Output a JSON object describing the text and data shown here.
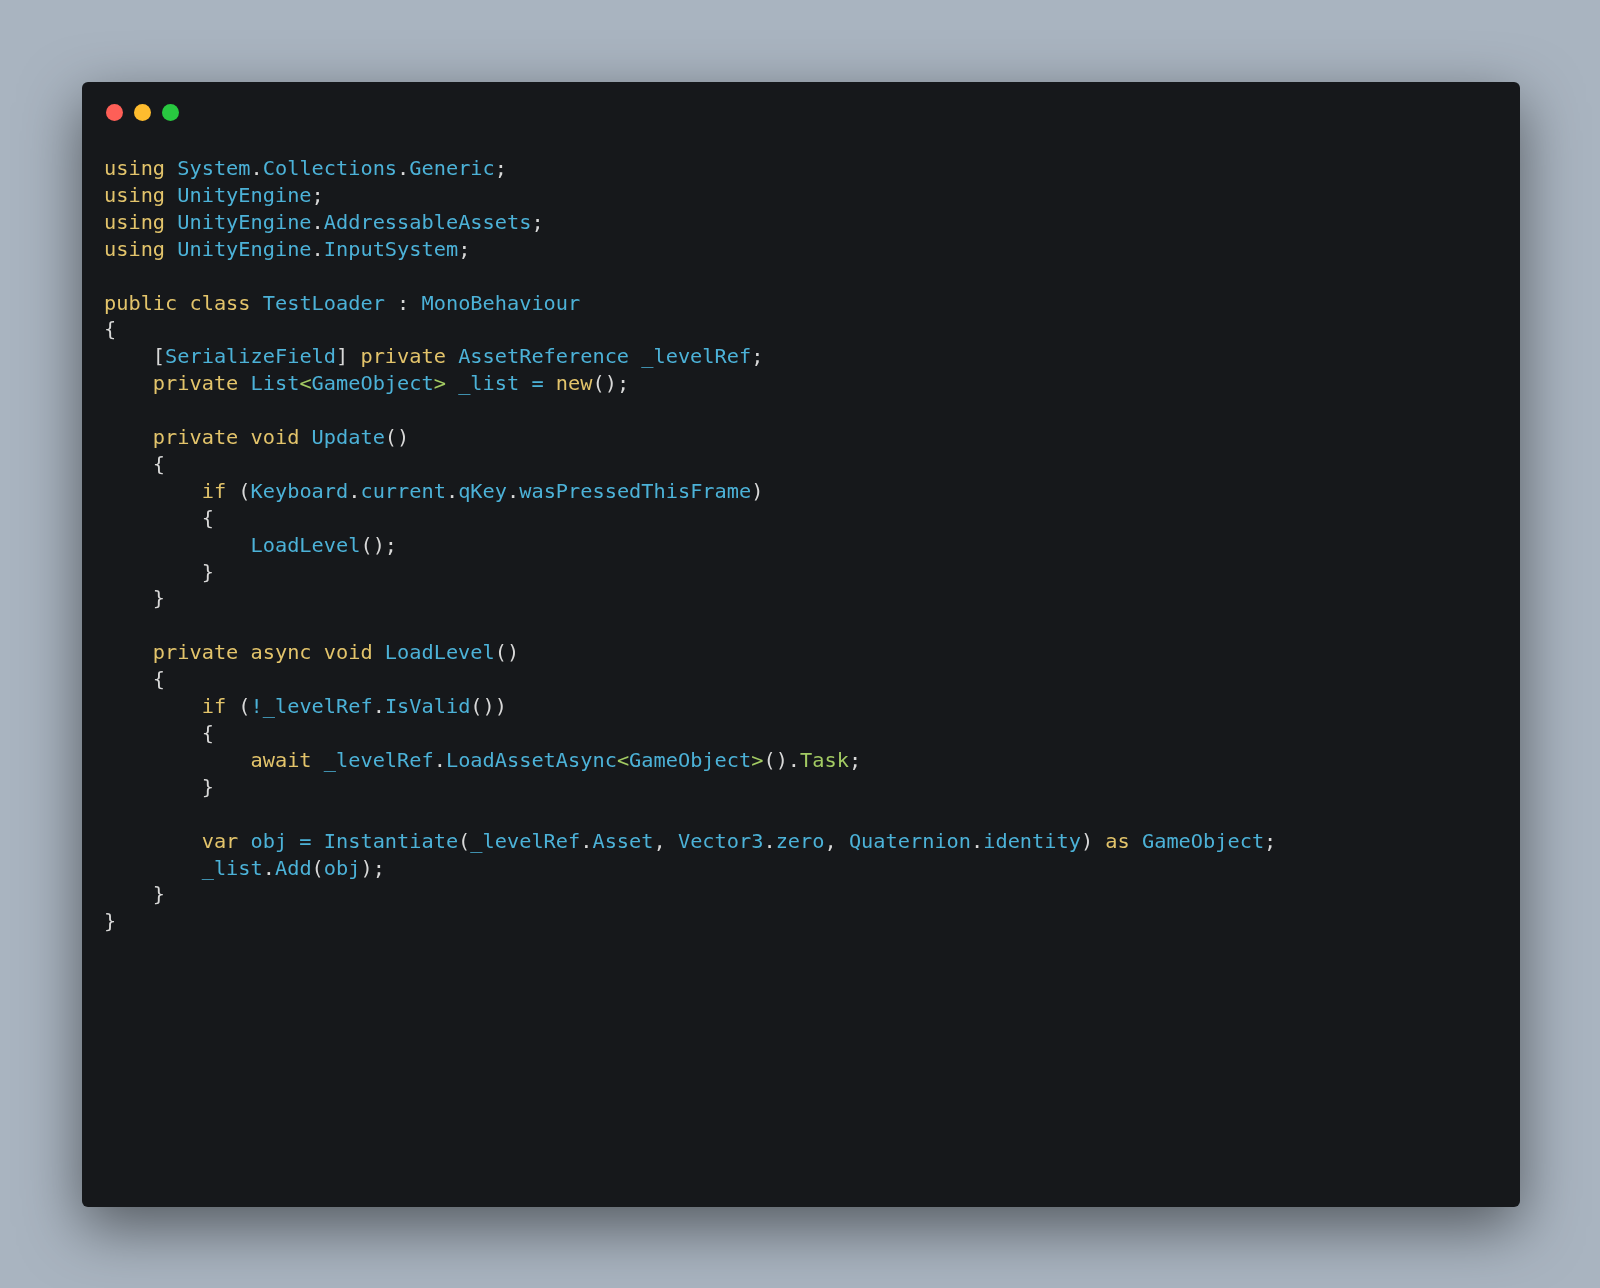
{
  "code_blocks": [
    [
      [
        {
          "kind": "keyword",
          "text": "using "
        },
        {
          "kind": "name",
          "text": "System"
        },
        {
          "kind": "punct",
          "text": "."
        },
        {
          "kind": "name",
          "text": "Collections"
        },
        {
          "kind": "punct",
          "text": "."
        },
        {
          "kind": "name",
          "text": "Generic"
        },
        {
          "kind": "punct",
          "text": ";"
        }
      ],
      [
        {
          "kind": "keyword",
          "text": "using "
        },
        {
          "kind": "name",
          "text": "UnityEngine"
        },
        {
          "kind": "punct",
          "text": ";"
        }
      ],
      [
        {
          "kind": "keyword",
          "text": "using "
        },
        {
          "kind": "name",
          "text": "UnityEngine"
        },
        {
          "kind": "punct",
          "text": "."
        },
        {
          "kind": "name",
          "text": "AddressableAssets"
        },
        {
          "kind": "punct",
          "text": ";"
        }
      ],
      [
        {
          "kind": "keyword",
          "text": "using "
        },
        {
          "kind": "name",
          "text": "UnityEngine"
        },
        {
          "kind": "punct",
          "text": "."
        },
        {
          "kind": "name",
          "text": "InputSystem"
        },
        {
          "kind": "punct",
          "text": ";"
        }
      ]
    ],
    [
      [
        {
          "kind": "keyword",
          "text": "public class "
        },
        {
          "kind": "name",
          "text": "TestLoader"
        },
        {
          "kind": "punct",
          "text": " : "
        },
        {
          "kind": "name",
          "text": "MonoBehaviour"
        }
      ],
      [
        {
          "kind": "punct",
          "text": "{"
        }
      ],
      [
        {
          "kind": "punct",
          "text": "    ["
        },
        {
          "kind": "name",
          "text": "SerializeField"
        },
        {
          "kind": "punct",
          "text": "] "
        },
        {
          "kind": "keyword",
          "text": "private "
        },
        {
          "kind": "name",
          "text": "AssetReference _levelRef"
        },
        {
          "kind": "punct",
          "text": ";"
        }
      ],
      [
        {
          "kind": "keyword",
          "text": "    private "
        },
        {
          "kind": "name",
          "text": "List"
        },
        {
          "kind": "generic",
          "text": "<"
        },
        {
          "kind": "name",
          "text": "GameObject"
        },
        {
          "kind": "generic",
          "text": ">"
        },
        {
          "kind": "name",
          "text": " _list = "
        },
        {
          "kind": "keyword",
          "text": "new"
        },
        {
          "kind": "punct",
          "text": "();"
        }
      ]
    ],
    [
      [
        {
          "kind": "keyword",
          "text": "    private void "
        },
        {
          "kind": "name",
          "text": "Update"
        },
        {
          "kind": "punct",
          "text": "()"
        }
      ],
      [
        {
          "kind": "punct",
          "text": "    {"
        }
      ],
      [
        {
          "kind": "keyword",
          "text": "        if "
        },
        {
          "kind": "punct",
          "text": "("
        },
        {
          "kind": "name",
          "text": "Keyboard"
        },
        {
          "kind": "punct",
          "text": "."
        },
        {
          "kind": "name",
          "text": "current"
        },
        {
          "kind": "punct",
          "text": "."
        },
        {
          "kind": "name",
          "text": "qKey"
        },
        {
          "kind": "punct",
          "text": "."
        },
        {
          "kind": "name",
          "text": "wasPressedThisFrame"
        },
        {
          "kind": "punct",
          "text": ")"
        }
      ],
      [
        {
          "kind": "punct",
          "text": "        {"
        }
      ],
      [
        {
          "kind": "name",
          "text": "            LoadLevel"
        },
        {
          "kind": "punct",
          "text": "();"
        }
      ],
      [
        {
          "kind": "punct",
          "text": "        }"
        }
      ],
      [
        {
          "kind": "punct",
          "text": "    }"
        }
      ]
    ],
    [
      [
        {
          "kind": "keyword",
          "text": "    private async void "
        },
        {
          "kind": "name",
          "text": "LoadLevel"
        },
        {
          "kind": "punct",
          "text": "()"
        }
      ],
      [
        {
          "kind": "punct",
          "text": "    {"
        }
      ],
      [
        {
          "kind": "keyword",
          "text": "        if "
        },
        {
          "kind": "punct",
          "text": "("
        },
        {
          "kind": "name",
          "text": "!_levelRef"
        },
        {
          "kind": "punct",
          "text": "."
        },
        {
          "kind": "name",
          "text": "IsValid"
        },
        {
          "kind": "punct",
          "text": "())"
        }
      ],
      [
        {
          "kind": "punct",
          "text": "        {"
        }
      ],
      [
        {
          "kind": "keyword",
          "text": "            await "
        },
        {
          "kind": "name",
          "text": "_levelRef"
        },
        {
          "kind": "punct",
          "text": "."
        },
        {
          "kind": "name",
          "text": "LoadAssetAsync"
        },
        {
          "kind": "generic",
          "text": "<"
        },
        {
          "kind": "name",
          "text": "GameObject"
        },
        {
          "kind": "generic",
          "text": ">"
        },
        {
          "kind": "punct",
          "text": "()."
        },
        {
          "kind": "generic",
          "text": "Task"
        },
        {
          "kind": "punct",
          "text": ";"
        }
      ],
      [
        {
          "kind": "punct",
          "text": "        }"
        }
      ]
    ],
    [
      [
        {
          "kind": "keyword",
          "text": "        var "
        },
        {
          "kind": "name",
          "text": "obj = Instantiate"
        },
        {
          "kind": "punct",
          "text": "("
        },
        {
          "kind": "name",
          "text": "_levelRef"
        },
        {
          "kind": "punct",
          "text": "."
        },
        {
          "kind": "name",
          "text": "Asset"
        },
        {
          "kind": "punct",
          "text": ", "
        },
        {
          "kind": "name",
          "text": "Vector3"
        },
        {
          "kind": "punct",
          "text": "."
        },
        {
          "kind": "name",
          "text": "zero"
        },
        {
          "kind": "punct",
          "text": ", "
        },
        {
          "kind": "name",
          "text": "Quaternion"
        },
        {
          "kind": "punct",
          "text": "."
        },
        {
          "kind": "name",
          "text": "identity"
        },
        {
          "kind": "punct",
          "text": ") "
        },
        {
          "kind": "keyword",
          "text": "as "
        },
        {
          "kind": "name",
          "text": "GameObject"
        },
        {
          "kind": "punct",
          "text": ";"
        }
      ],
      [
        {
          "kind": "name",
          "text": "        _list"
        },
        {
          "kind": "punct",
          "text": "."
        },
        {
          "kind": "name",
          "text": "Add"
        },
        {
          "kind": "punct",
          "text": "("
        },
        {
          "kind": "name",
          "text": "obj"
        },
        {
          "kind": "punct",
          "text": ");"
        }
      ],
      [
        {
          "kind": "punct",
          "text": "    }"
        }
      ],
      [
        {
          "kind": "punct",
          "text": "}"
        }
      ]
    ]
  ]
}
